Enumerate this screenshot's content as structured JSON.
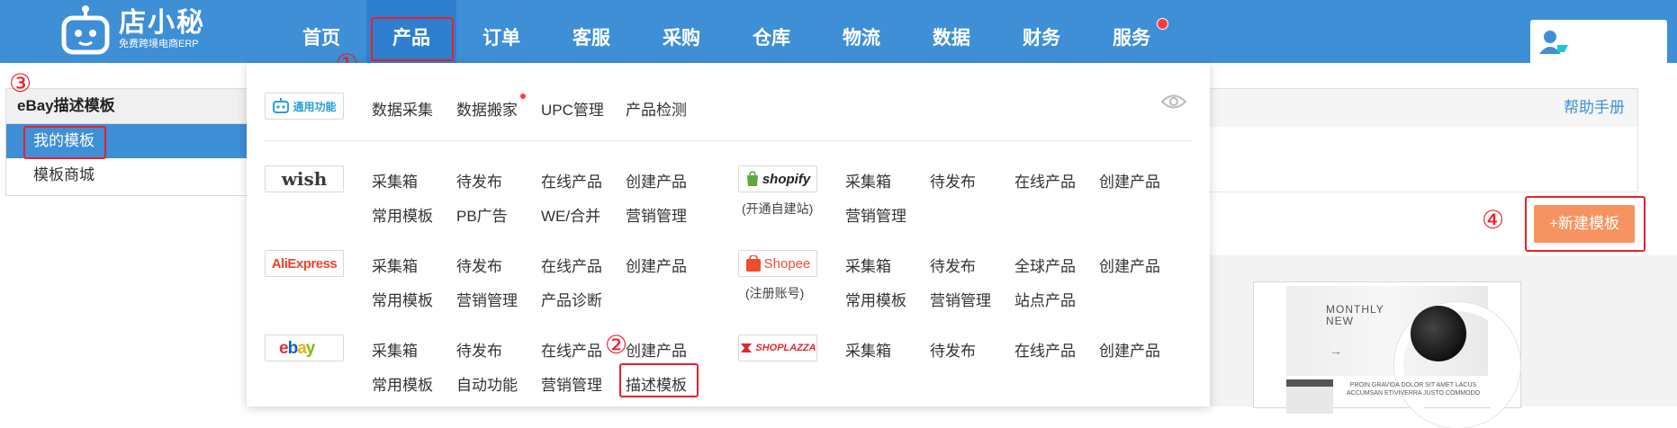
{
  "brand": {
    "name": "店小秘",
    "tagline": "免费跨境电商ERP"
  },
  "nav": [
    {
      "label": "首页"
    },
    {
      "label": "产品"
    },
    {
      "label": "订单"
    },
    {
      "label": "客服"
    },
    {
      "label": "采购"
    },
    {
      "label": "仓库"
    },
    {
      "label": "物流"
    },
    {
      "label": "数据"
    },
    {
      "label": "财务"
    },
    {
      "label": "服务"
    }
  ],
  "annotations": [
    "①",
    "②",
    "③",
    "④"
  ],
  "left_panel": {
    "title": "eBay描述模板",
    "items": [
      {
        "label": "我的模板"
      },
      {
        "label": "模板商城"
      }
    ]
  },
  "right": {
    "help_link": "帮助手册",
    "new_button": "+新建模板",
    "preview": {
      "hero_text": "MONTHLY NEW",
      "arrow": "→",
      "caption": "PROIN GRAVIDA DOLOR SIT AMET LACUS ACCUMSAN ETIVIVERRA JUSTO COMMODO"
    }
  },
  "menu": {
    "general": {
      "logo_text": "通用功能",
      "links": [
        "数据采集",
        "数据搬家",
        "UPC管理",
        "产品检测"
      ]
    },
    "wish": {
      "logo_text": "wish",
      "links": [
        "采集箱",
        "待发布",
        "在线产品",
        "创建产品",
        "常用模板",
        "PB广告",
        "WE/合并",
        "营销管理"
      ]
    },
    "shopify": {
      "logo_text": "shopify",
      "sub": "(开通自建站)",
      "links": [
        "采集箱",
        "待发布",
        "在线产品",
        "创建产品",
        "营销管理"
      ]
    },
    "aliexpress": {
      "logo_text": "AliExpress",
      "links": [
        "采集箱",
        "待发布",
        "在线产品",
        "创建产品",
        "常用模板",
        "营销管理",
        "产品诊断"
      ]
    },
    "shopee": {
      "logo_text": "Shopee",
      "sub": "(注册账号)",
      "links": [
        "采集箱",
        "待发布",
        "全球产品",
        "创建产品",
        "常用模板",
        "营销管理",
        "站点产品"
      ]
    },
    "ebay": {
      "logo_text": "ebay",
      "links": [
        "采集箱",
        "待发布",
        "在线产品",
        "创建产品",
        "常用模板",
        "自动功能",
        "营销管理",
        "描述模板"
      ]
    },
    "shoplazza": {
      "logo_text": "SHOPLAZZA",
      "links": [
        "采集箱",
        "待发布",
        "在线产品",
        "创建产品"
      ]
    }
  },
  "colors": {
    "topbar": "#3e8fd6",
    "annotation_red": "#e8202a",
    "new_button": "#f79360"
  }
}
